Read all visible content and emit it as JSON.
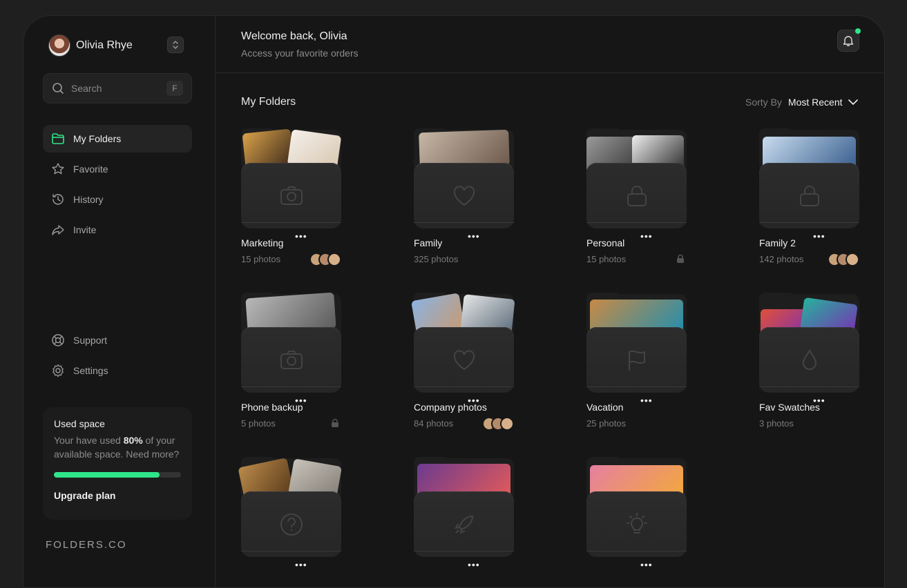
{
  "user": {
    "name": "Olivia Rhye"
  },
  "search": {
    "placeholder": "Search",
    "shortcut": "F"
  },
  "nav": {
    "items": [
      {
        "label": "My Folders",
        "icon": "folder-icon",
        "active": true
      },
      {
        "label": "Favorite",
        "icon": "star-icon"
      },
      {
        "label": "History",
        "icon": "history-icon"
      },
      {
        "label": "Invite",
        "icon": "share-icon"
      }
    ],
    "bottom": [
      {
        "label": "Support",
        "icon": "lifebuoy-icon"
      },
      {
        "label": "Settings",
        "icon": "gear-icon"
      }
    ]
  },
  "storage": {
    "title": "Used space",
    "desc_prefix": "Your have used ",
    "percent_text": "80%",
    "desc_suffix": " of your available space. Need more?",
    "used_fraction": 0.83,
    "cta": "Upgrade plan",
    "accent": "#2fe58a"
  },
  "brand": "FOLDERS.CO",
  "header": {
    "title": "Welcome back, Olivia",
    "subtitle": "Access your favorite orders"
  },
  "main": {
    "section_title": "My Folders",
    "sort_label": "Sorty By",
    "sort_value": "Most Recent"
  },
  "folders": [
    {
      "name": "Marketing",
      "count": "15 photos",
      "icon": "camera-icon",
      "extra": "avatars"
    },
    {
      "name": "Family",
      "count": "325 photos",
      "icon": "heart-icon",
      "extra": "none"
    },
    {
      "name": "Personal",
      "count": "15 photos",
      "icon": "lock-icon",
      "extra": "lock"
    },
    {
      "name": "Family 2",
      "count": "142 photos",
      "icon": "lock-icon",
      "extra": "avatars"
    },
    {
      "name": "Phone backup",
      "count": "5 photos",
      "icon": "camera-icon",
      "extra": "lock"
    },
    {
      "name": "Company photos",
      "count": "84 photos",
      "icon": "heart-icon",
      "extra": "avatars"
    },
    {
      "name": "Vacation",
      "count": "25 photos",
      "icon": "flag-icon",
      "extra": "none"
    },
    {
      "name": "Fav Swatches",
      "count": "3 photos",
      "icon": "drop-icon",
      "extra": "none"
    },
    {
      "name": "",
      "count": "",
      "icon": "question-icon",
      "extra": "none"
    },
    {
      "name": "",
      "count": "",
      "icon": "rocket-icon",
      "extra": "none"
    },
    {
      "name": "",
      "count": "",
      "icon": "lightbulb-icon",
      "extra": "none"
    }
  ],
  "more_label": "•••"
}
